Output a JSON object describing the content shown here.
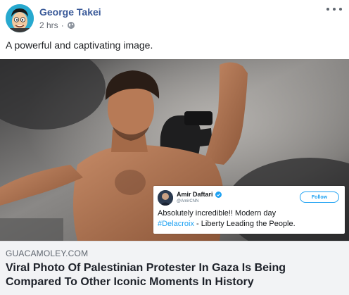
{
  "post": {
    "author": "George Takei",
    "timestamp": "2 hrs",
    "separator": "·",
    "privacy_icon": "globe-icon",
    "more_icon": "more-options-icon",
    "text": "A powerful and captivating image."
  },
  "photo": {
    "icon": "protester-photo"
  },
  "tweet": {
    "name": "Amir Daftari",
    "handle": "@AmirCNN",
    "follow_label": "Follow",
    "text_line1": "Absolutely incredible!!  Modern day",
    "hashtag": "#Delacroix",
    "text_rest": " - Liberty Leading the People.",
    "accent": "#1da1f2"
  },
  "link": {
    "domain": "GUACAMOLEY.COM",
    "title": "Viral Photo Of Palestinian Protester In Gaza Is Being Compared To Other Iconic Moments In History"
  },
  "colors": {
    "author_link": "#385898",
    "preview_bg": "#f2f3f5"
  }
}
